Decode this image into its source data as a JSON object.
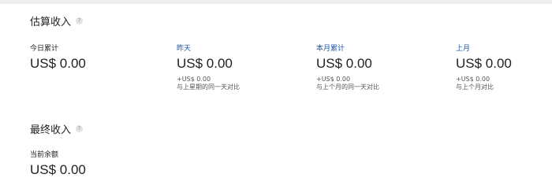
{
  "estimated": {
    "title": "估算收入",
    "help_glyph": "?",
    "metrics": [
      {
        "label": "今日累计",
        "value": "US$ 0.00",
        "delta": "",
        "compare": ""
      },
      {
        "label": "昨天",
        "value": "US$ 0.00",
        "delta": "+US$ 0.00",
        "compare": "与上星期的同一天对比"
      },
      {
        "label": "本月累计",
        "value": "US$ 0.00",
        "delta": "+US$ 0.00",
        "compare": "与上个月的同一天对比"
      },
      {
        "label": "上月",
        "value": "US$ 0.00",
        "delta": "+US$ 0.00",
        "compare": "与上个月对比"
      }
    ]
  },
  "final": {
    "title": "最终收入",
    "help_glyph": "?",
    "balance_label": "当前余额",
    "balance_value": "US$ 0.00"
  },
  "colors": {
    "link": "#1a55a8",
    "text": "#222222",
    "secondary": "#555555"
  }
}
